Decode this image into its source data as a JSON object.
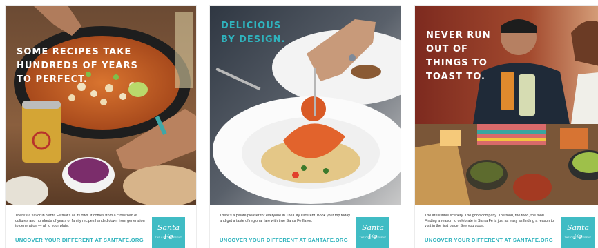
{
  "colors": {
    "brand_teal": "#40bcc4",
    "headline_teal": "#2fb3bd",
    "footer_text": "#333333"
  },
  "posters": [
    {
      "headline": "Some recipes take\nhundreds of years\nto perfect.",
      "body": "There's a flavor in Santa Fe that's all its own. It comes from a crossroad of cultures and hundreds of years of family recipes handed down from generation to generation — all to your plate.",
      "cta": "UNCOVER YOUR DIFFERENT AT SANTAFE.ORG",
      "logo_script": "Santa Fe",
      "logo_tag": "THE CITY DIFFERENT"
    },
    {
      "headline": "Delicious\nby design.",
      "body": "There's a palate pleaser for everyone in The City Different. Book your trip today and get a taste of regional fare with true Santa Fe flavor.",
      "cta": "UNCOVER YOUR DIFFERENT AT SANTAFE.ORG",
      "logo_script": "Santa Fe",
      "logo_tag": "THE CITY DIFFERENT"
    },
    {
      "headline": "Never run\nout of\nthings to\ntoast to.",
      "body": "The irresistible scenery. The good company. The food, the food, the food. Finding a reason to celebrate in Santa Fe is just as easy as finding a reason to visit in the first place. See you soon.",
      "cta": "UNCOVER YOUR DIFFERENT AT SANTAFE.ORG",
      "logo_script": "Santa Fe",
      "logo_tag": "THE CITY DIFFERENT"
    }
  ]
}
